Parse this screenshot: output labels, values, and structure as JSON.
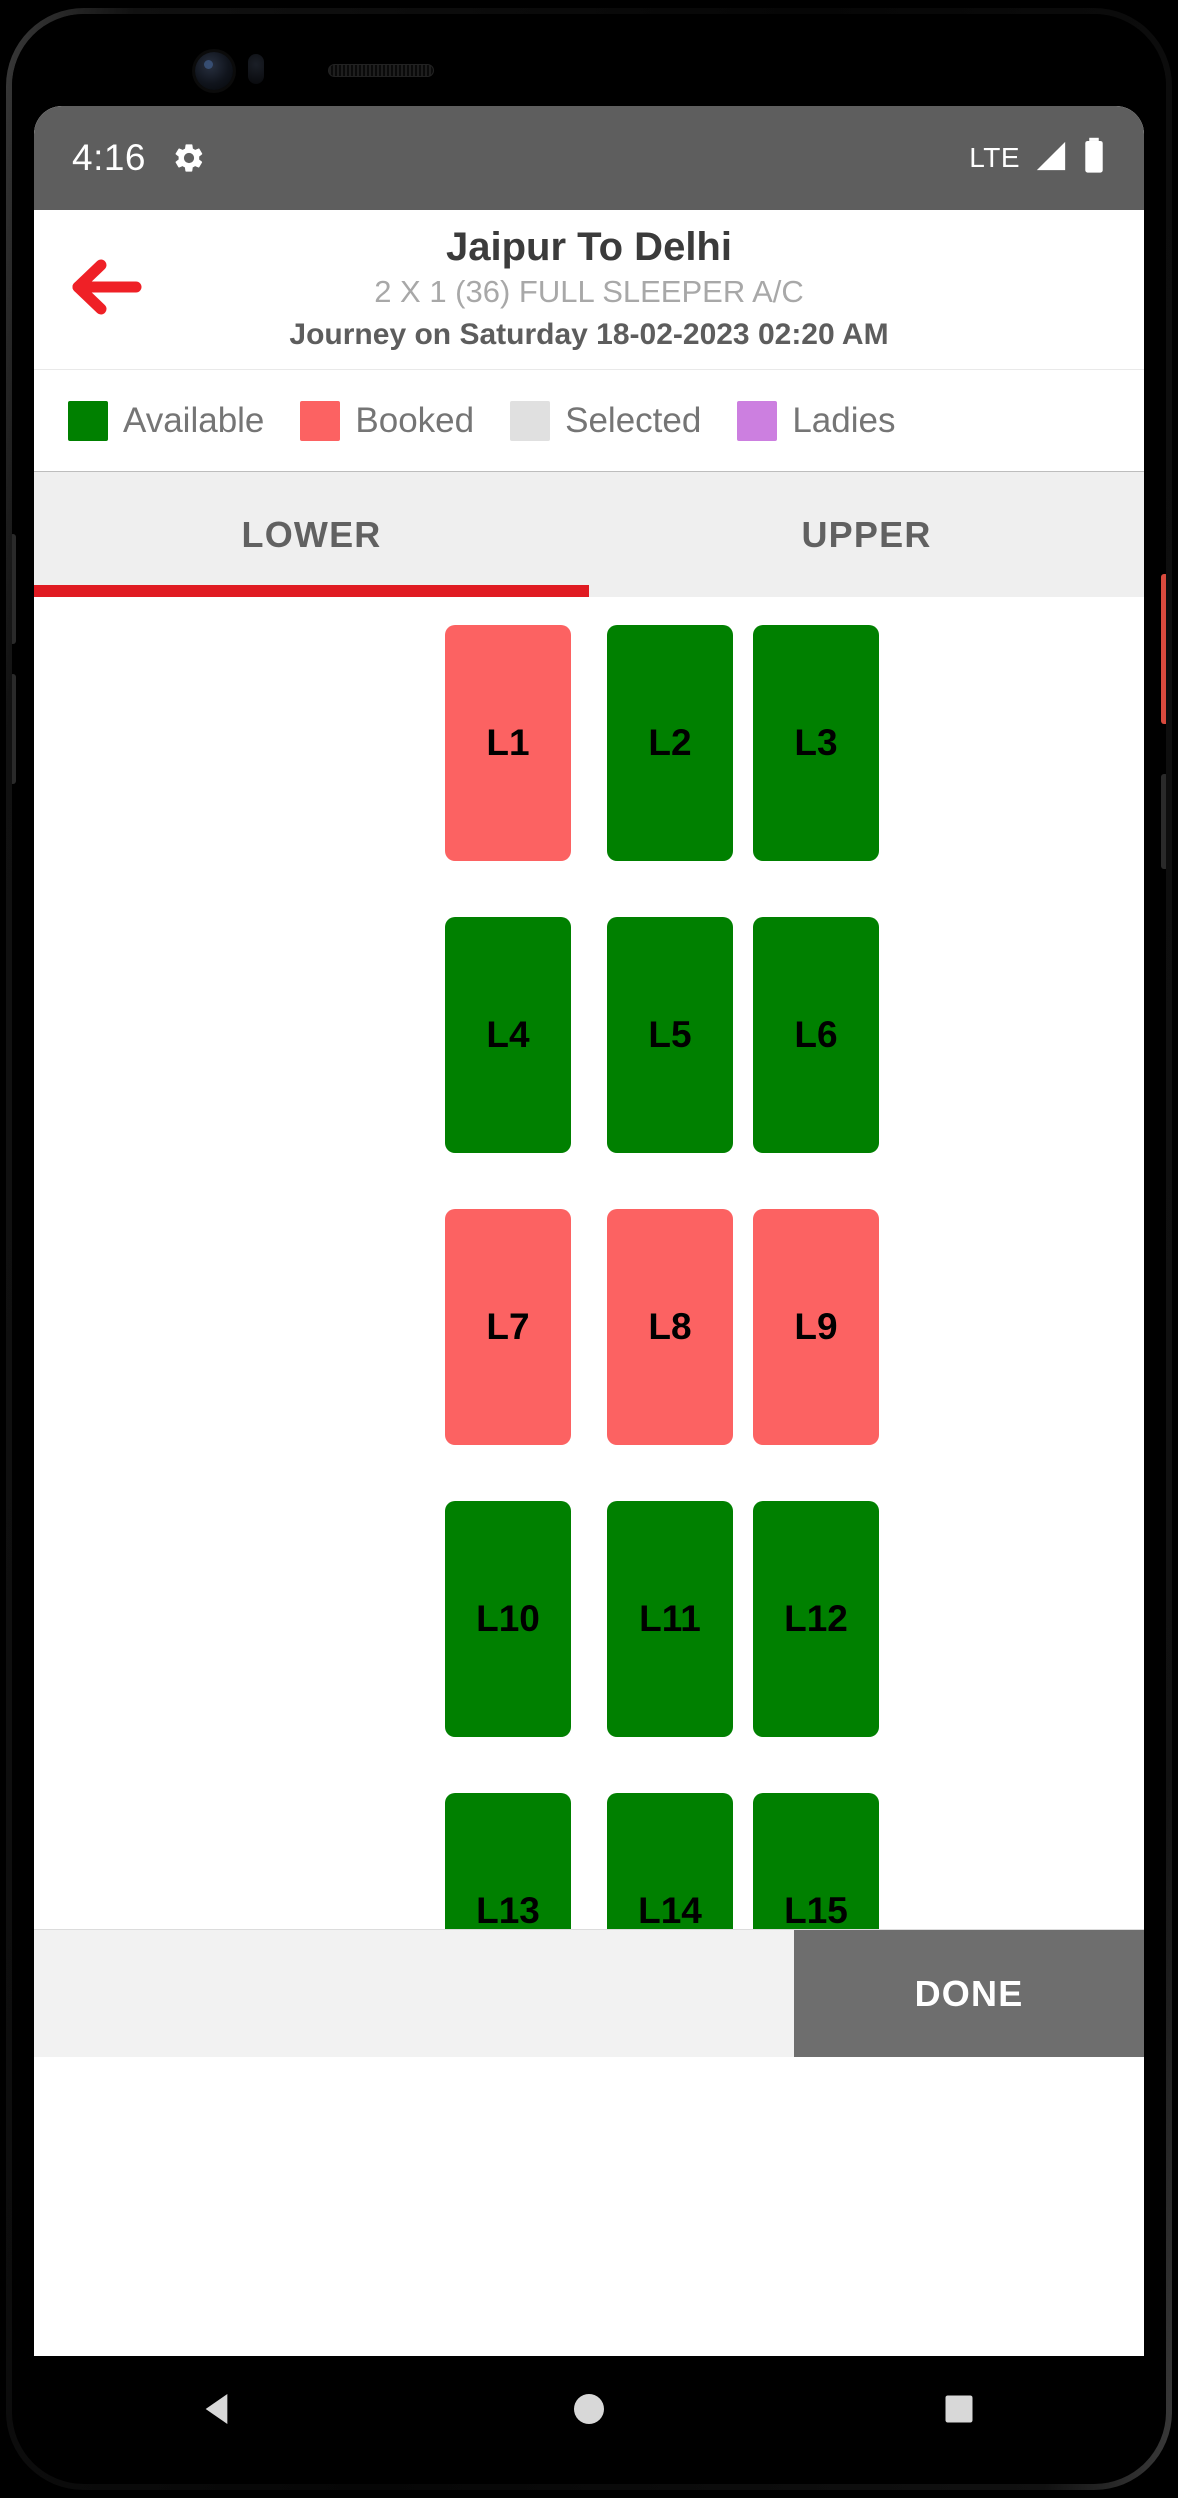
{
  "status_bar": {
    "time": "4:16",
    "settings_icon": "gear-icon",
    "network_label": "LTE",
    "signal_icon": "signal-bars-icon",
    "battery_icon": "battery-icon"
  },
  "header": {
    "back_icon": "arrow-left-icon",
    "route_title": "Jaipur To Delhi",
    "bus_type": "2 X 1 (36) FULL SLEEPER A/C",
    "journey_info": "Journey on Saturday 18-02-2023  02:20 AM"
  },
  "legend": {
    "items": [
      {
        "label": "Available",
        "color": "#008000"
      },
      {
        "label": "Booked",
        "color": "#fc6262"
      },
      {
        "label": "Selected",
        "color": "#e0e0e0"
      },
      {
        "label": "Ladies",
        "color": "#cc7fe0"
      }
    ]
  },
  "tabs": {
    "active_index": 0,
    "indicator_color": "#e01b22",
    "items": [
      {
        "label": "LOWER"
      },
      {
        "label": "UPPER"
      }
    ]
  },
  "seat_map": {
    "deck": "LOWER",
    "rows": [
      {
        "left": [
          {
            "label": "L1",
            "state": "booked"
          }
        ],
        "right": [
          {
            "label": "L2",
            "state": "available"
          },
          {
            "label": "L3",
            "state": "available"
          }
        ]
      },
      {
        "left": [
          {
            "label": "L4",
            "state": "available"
          }
        ],
        "right": [
          {
            "label": "L5",
            "state": "available"
          },
          {
            "label": "L6",
            "state": "available"
          }
        ]
      },
      {
        "left": [
          {
            "label": "L7",
            "state": "booked"
          }
        ],
        "right": [
          {
            "label": "L8",
            "state": "booked"
          },
          {
            "label": "L9",
            "state": "booked"
          }
        ]
      },
      {
        "left": [
          {
            "label": "L10",
            "state": "available"
          }
        ],
        "right": [
          {
            "label": "L11",
            "state": "available"
          },
          {
            "label": "L12",
            "state": "available"
          }
        ]
      },
      {
        "left": [
          {
            "label": "L13",
            "state": "available"
          }
        ],
        "right": [
          {
            "label": "L14",
            "state": "available"
          },
          {
            "label": "L15",
            "state": "available"
          }
        ]
      }
    ]
  },
  "bottom_bar": {
    "fare_text": "",
    "done_label": "DONE"
  },
  "nav_bar": {
    "back_icon": "triangle-back-icon",
    "home_icon": "circle-home-icon",
    "recents_icon": "square-recents-icon"
  }
}
